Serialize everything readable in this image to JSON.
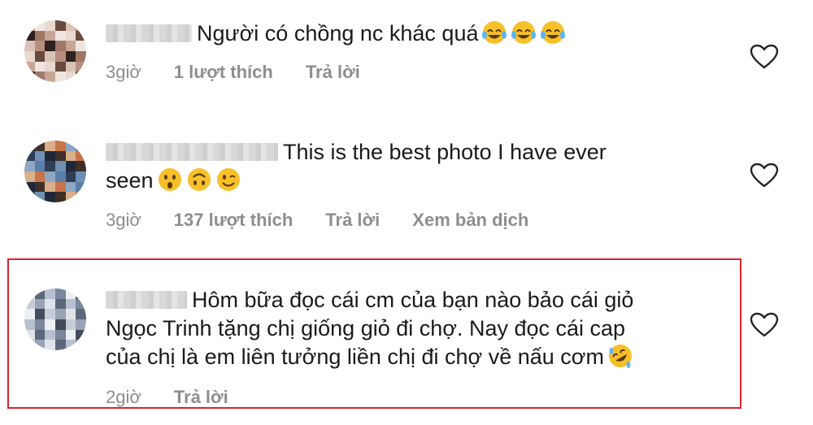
{
  "comments": [
    {
      "text": "Người có chồng nc khác quá",
      "emojis": [
        "tears-of-joy-emoji",
        "tears-of-joy-emoji",
        "tears-of-joy-emoji"
      ],
      "time": "3giờ",
      "likes": "1 lượt thích",
      "reply": "Trả lời"
    },
    {
      "text_line1": "This is the best photo I have ever",
      "text_line2": "seen",
      "emojis": [
        "hushed-face-emoji",
        "upside-down-face-emoji",
        "winking-face-emoji"
      ],
      "time": "3giờ",
      "likes": "137 lượt thích",
      "reply": "Trả lời",
      "translate": "Xem bản dịch"
    },
    {
      "text_line1": "Hôm bữa đọc cái cm của bạn nào bảo cái giỏ",
      "text_line2": "Ngọc Trinh tặng chị giống giỏ đi chợ. Nay đọc cái cap",
      "text_line3": "của chị là em liên tưởng liền chị đi chợ về nấu cơm",
      "emojis": [
        "rolling-on-floor-laughing-emoji"
      ],
      "time": "2giờ",
      "reply": "Trả lời"
    }
  ],
  "colors": {
    "text": "#1a1a1a",
    "meta": "#8e8e8e",
    "highlight_border": "#d9232d",
    "emoji_yellow": "#f7c02b"
  },
  "icons": {
    "like": "heart-outline-icon"
  }
}
